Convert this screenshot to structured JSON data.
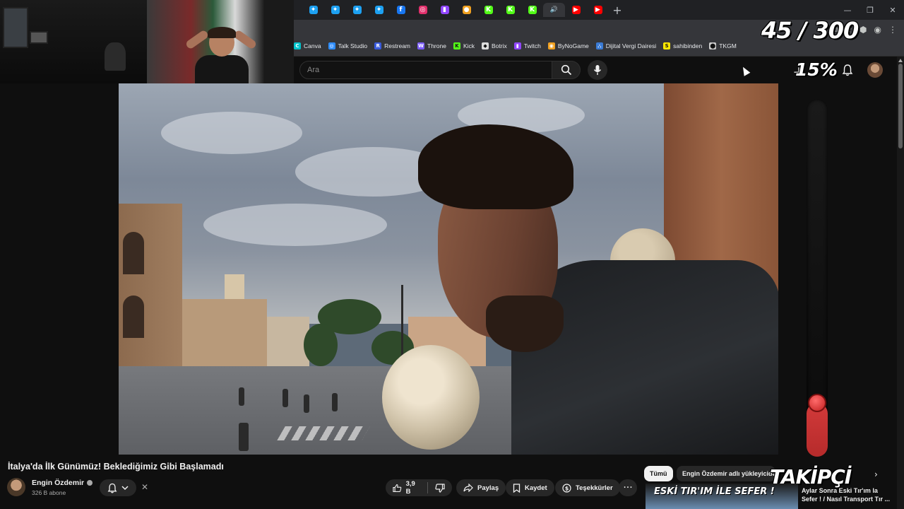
{
  "browser": {
    "tabs": [
      {
        "icon": "star-icon",
        "color": "#1da1f2",
        "glyph": "✦"
      },
      {
        "icon": "star-icon",
        "color": "#1da1f2",
        "glyph": "✦"
      },
      {
        "icon": "star-icon",
        "color": "#1da1f2",
        "glyph": "✦"
      },
      {
        "icon": "star-icon",
        "color": "#1da1f2",
        "glyph": "✦"
      },
      {
        "icon": "facebook-icon",
        "color": "#1877f2",
        "glyph": "f"
      },
      {
        "icon": "instagram-icon",
        "color": "#e1306c",
        "glyph": "◎"
      },
      {
        "icon": "twitch-icon",
        "color": "#9146ff",
        "glyph": "▮"
      },
      {
        "icon": "bynogame-icon",
        "color": "#f0a020",
        "glyph": "●"
      },
      {
        "icon": "kick-icon",
        "color": "#53fc18",
        "glyph": "K"
      },
      {
        "icon": "kick-icon",
        "color": "#53fc18",
        "glyph": "K"
      },
      {
        "icon": "kick-icon",
        "color": "#53fc18",
        "glyph": "K"
      },
      {
        "icon": "speaker-icon",
        "color": "#9aa0a6",
        "glyph": "🔊",
        "active": true
      },
      {
        "icon": "youtube-icon",
        "color": "#ff0000",
        "glyph": "▶"
      },
      {
        "icon": "youtube-icon",
        "color": "#ff0000",
        "glyph": "▶"
      }
    ],
    "new_tab_glyph": "+",
    "window_controls": {
      "minimize": "—",
      "restore": "❐",
      "close": "✕"
    }
  },
  "bookmarks": [
    {
      "label": "Canva",
      "color": "#00c4cc",
      "glyph": "C"
    },
    {
      "label": "Talk Studio",
      "color": "#2d8cff",
      "glyph": "◎"
    },
    {
      "label": "Restream",
      "color": "#3a5bdc",
      "glyph": "R"
    },
    {
      "label": "Throne",
      "color": "#7b5cff",
      "glyph": "W"
    },
    {
      "label": "Kick",
      "color": "#53fc18",
      "glyph": "K"
    },
    {
      "label": "Botrix",
      "color": "#dddddd",
      "glyph": "◆"
    },
    {
      "label": "Twitch",
      "color": "#9146ff",
      "glyph": "▮"
    },
    {
      "label": "ByNoGame",
      "color": "#f0a020",
      "glyph": "◉"
    },
    {
      "label": "Dijital Vergi Dairesi",
      "color": "#3a7bd5",
      "glyph": "⛬"
    },
    {
      "label": "sahibinden",
      "color": "#ffe800",
      "glyph": "S"
    },
    {
      "label": "TKGM",
      "color": "#cccccc",
      "glyph": "⬤"
    }
  ],
  "overlay": {
    "counter": "45 / 300",
    "percent": "15%",
    "meter_level": 0.15,
    "takipci": "TAKİPÇİ"
  },
  "youtube": {
    "search_placeholder": "Ara",
    "video_title": "İtalya'da İlk Günümüz! Beklediğimiz Gibi Başlamadı",
    "channel_name": "Engin Özdemir",
    "subscribers": "326 B abone",
    "dismiss": "✕",
    "likes": "3,9 B",
    "share_label": "Paylaş",
    "save_label": "Kaydet",
    "thanks_label": "Teşekkürler",
    "more": "···",
    "chips": {
      "all": "Tümü",
      "uploader": "Engin Özdemir adlı yükleyiciden"
    },
    "chip_next": "›",
    "related": {
      "thumb_text": "ESKİ TIR'IM İLE SEFER !",
      "title": "Aylar Sonra Eski Tır'ım la Sefer ! / Nasıl Transport Tır ..."
    }
  },
  "colors": {
    "accent": "#ff0000",
    "meter_fill": "#c12a2a",
    "background": "#0f0f0f"
  }
}
